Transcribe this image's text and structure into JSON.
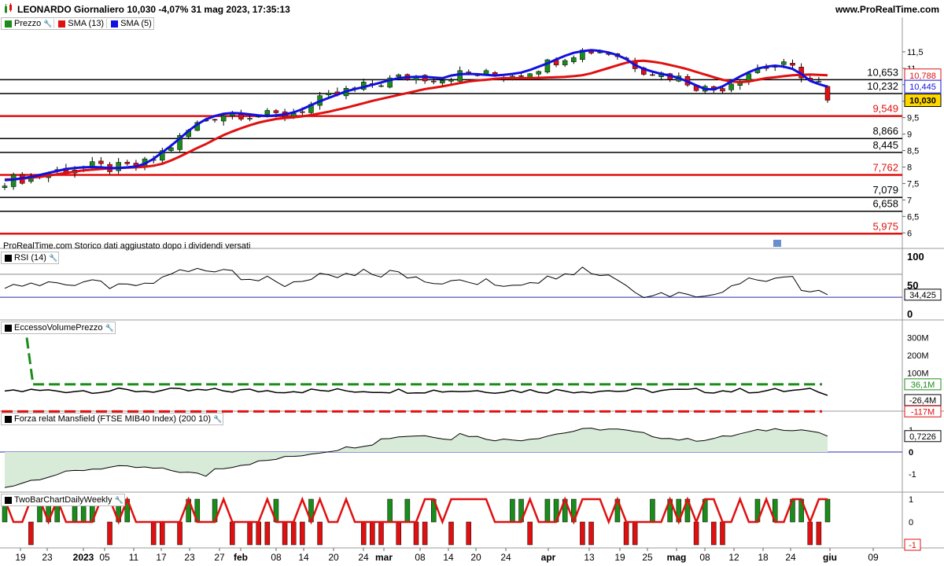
{
  "header": {
    "title": "LEONARDO Giornaliero 10,030 -4,07% 31 mag 2023, 17:35:13",
    "site": "www.ProRealTime.com"
  },
  "price_panel": {
    "legend": [
      "Prezzo",
      "SMA (13)",
      "SMA (5)"
    ],
    "legend_colors": [
      "#1a8c1a",
      "#e01010",
      "#1010e0"
    ],
    "y_ticks": [
      "11,5",
      "11",
      "10,5",
      "10",
      "9,5",
      "9",
      "8,5",
      "8",
      "7,5",
      "7",
      "6,5",
      "6"
    ],
    "levels": [
      {
        "value": 10.653,
        "label": "10,653",
        "color": "#000000"
      },
      {
        "value": 10.232,
        "label": "10,232",
        "color": "#000000"
      },
      {
        "value": 9.549,
        "label": "9,549",
        "color": "#e01010"
      },
      {
        "value": 8.866,
        "label": "8,866",
        "color": "#000000"
      },
      {
        "value": 8.445,
        "label": "8,445",
        "color": "#000000"
      },
      {
        "value": 7.762,
        "label": "7,762",
        "color": "#e01010"
      },
      {
        "value": 7.079,
        "label": "7,079",
        "color": "#000000"
      },
      {
        "value": 6.658,
        "label": "6,658",
        "color": "#000000"
      },
      {
        "value": 5.975,
        "label": "5,975",
        "color": "#e01010"
      }
    ],
    "value_tags": [
      {
        "value": 10.788,
        "label": "10,788",
        "color": "#e01010"
      },
      {
        "value": 10.445,
        "label": "10,445",
        "color": "#1010e0"
      },
      {
        "value": 10.03,
        "label": "10,030",
        "color": "#000000",
        "highlight": "#ffd700"
      }
    ],
    "footnote": "ProRealTime.com Storico dati aggiustato dopo i dividendi versati"
  },
  "rsi_panel": {
    "legend": "RSI (14)",
    "y_ticks": [
      "100",
      "50",
      "0"
    ],
    "value_label": "34,425",
    "upper": 70,
    "lower": 30
  },
  "evp_panel": {
    "legend": "EccessoVolumePrezzo",
    "y_ticks": [
      "300M",
      "200M",
      "100M"
    ],
    "value_tags": [
      {
        "label": "36,1M",
        "color": "#1a8c1a"
      },
      {
        "label": "-26,4M",
        "color": "#000000"
      },
      {
        "label": "-117M",
        "color": "#e01010"
      }
    ]
  },
  "mansfield_panel": {
    "legend": "Forza relat Mansfield (FTSE MIB40 Index) (200 10)",
    "y_ticks": [
      "1",
      "0",
      "-1"
    ],
    "value_label": "0,7226"
  },
  "twobar_panel": {
    "legend": "TwoBarChartDailyWeekly",
    "y_ticks": [
      "1",
      "0",
      "-1"
    ],
    "value_label": "-1"
  },
  "x_axis": {
    "labels": [
      "19",
      "23",
      "2023",
      "05",
      "11",
      "17",
      "23",
      "27",
      "feb",
      "08",
      "14",
      "20",
      "24",
      "mar",
      "08",
      "14",
      "20",
      "24",
      "apr",
      "13",
      "19",
      "25",
      "mag",
      "08",
      "12",
      "18",
      "24",
      "giu",
      "09"
    ]
  },
  "chart_data": {
    "type": "candlestick",
    "period": "2022-12-19 to 2023-05-31, daily",
    "last_close": 10.03,
    "sma13": [
      7.62,
      7.63,
      7.65,
      7.68,
      7.7,
      7.74,
      7.78,
      7.82,
      7.86,
      7.9,
      7.92,
      7.94,
      7.96,
      7.97,
      7.98,
      7.99,
      8.01,
      8.04,
      8.1,
      8.2,
      8.32,
      8.45,
      8.58,
      8.7,
      8.84,
      8.97,
      9.08,
      9.18,
      9.27,
      9.35,
      9.41,
      9.46,
      9.49,
      9.51,
      9.54,
      9.58,
      9.63,
      9.68,
      9.74,
      9.8,
      9.87,
      9.94,
      10.01,
      10.07,
      10.13,
      10.19,
      10.25,
      10.31,
      10.37,
      10.41,
      10.45,
      10.5,
      10.55,
      10.6,
      10.63,
      10.65,
      10.68,
      10.7,
      10.7,
      10.7,
      10.7,
      10.71,
      10.72,
      10.73,
      10.74,
      10.76,
      10.79,
      10.85,
      10.93,
      11.01,
      11.09,
      11.17,
      11.22,
      11.23,
      11.2,
      11.16,
      11.1,
      11.04,
      10.97,
      10.89,
      10.81,
      10.73,
      10.65,
      10.6,
      10.58,
      10.6,
      10.65,
      10.7,
      10.73,
      10.76,
      10.79,
      10.8,
      10.81,
      10.8,
      10.79
    ],
    "sma5": [
      7.6,
      7.62,
      7.66,
      7.7,
      7.76,
      7.82,
      7.88,
      7.94,
      7.97,
      7.99,
      8.0,
      7.99,
      7.97,
      7.97,
      7.99,
      8.02,
      8.1,
      8.25,
      8.45,
      8.65,
      8.87,
      9.1,
      9.3,
      9.45,
      9.55,
      9.62,
      9.64,
      9.63,
      9.6,
      9.57,
      9.55,
      9.57,
      9.6,
      9.66,
      9.76,
      9.88,
      10.0,
      10.1,
      10.2,
      10.3,
      10.37,
      10.43,
      10.5,
      10.57,
      10.64,
      10.7,
      10.73,
      10.74,
      10.74,
      10.72,
      10.7,
      10.78,
      10.82,
      10.83,
      10.82,
      10.8,
      10.78,
      10.8,
      10.83,
      10.87,
      10.95,
      11.05,
      11.15,
      11.27,
      11.38,
      11.47,
      11.52,
      11.55,
      11.53,
      11.48,
      11.4,
      11.28,
      11.1,
      10.98,
      10.9,
      10.83,
      10.78,
      10.7,
      10.6,
      10.48,
      10.37,
      10.36,
      10.45,
      10.6,
      10.75,
      10.88,
      10.99,
      11.05,
      11.08,
      11.05,
      10.98,
      10.83,
      10.62,
      10.52,
      10.44
    ],
    "rsi_last": 34.425,
    "mansfield_last": 0.7226,
    "evp": {
      "upper": 36.1,
      "mid": -26.4,
      "lower": -117,
      "unit": "M"
    }
  }
}
